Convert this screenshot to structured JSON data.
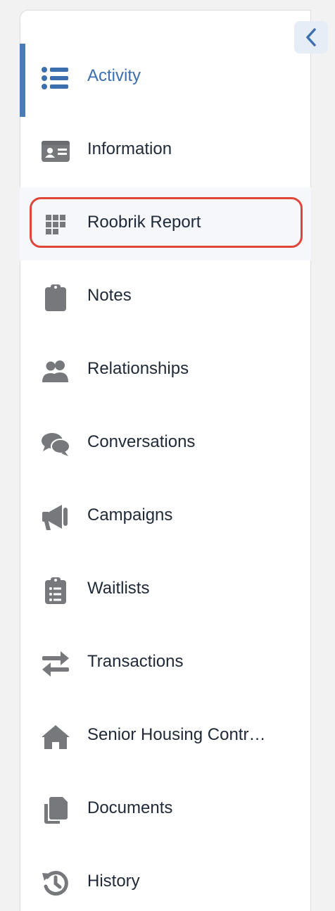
{
  "sidebar": {
    "collapse_icon": "chevron-left-icon",
    "accent_color": "#4a7bb7",
    "highlight_color": "#e0453a",
    "items": [
      {
        "label": "Activity",
        "icon": "list-icon",
        "active": true
      },
      {
        "label": "Information",
        "icon": "id-card-icon"
      },
      {
        "label": "Roobrik Report",
        "icon": "grid-icon",
        "highlighted": true
      },
      {
        "label": "Notes",
        "icon": "clipboard-icon"
      },
      {
        "label": "Relationships",
        "icon": "users-icon"
      },
      {
        "label": "Conversations",
        "icon": "comments-icon"
      },
      {
        "label": "Campaigns",
        "icon": "megaphone-icon"
      },
      {
        "label": "Waitlists",
        "icon": "clipboard-list-icon"
      },
      {
        "label": "Transactions",
        "icon": "exchange-arrows-icon"
      },
      {
        "label": "Senior Housing Contr…",
        "icon": "home-icon"
      },
      {
        "label": "Documents",
        "icon": "copy-icon"
      },
      {
        "label": "History",
        "icon": "history-icon"
      }
    ]
  }
}
